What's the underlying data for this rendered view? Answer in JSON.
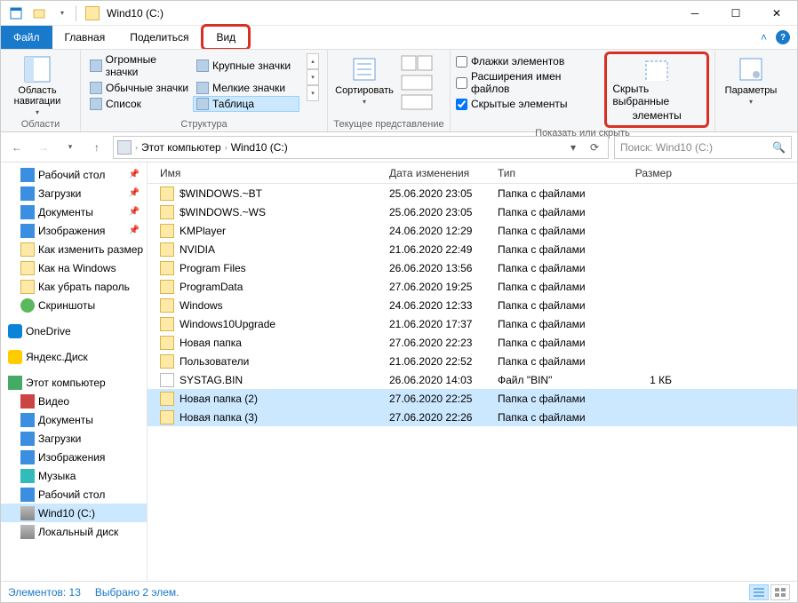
{
  "title": "Wind10 (C:)",
  "tabs": {
    "file": "Файл",
    "home": "Главная",
    "share": "Поделиться",
    "view": "Вид"
  },
  "ribbon": {
    "panes_group": "Области",
    "navpanes_btn": "Область навигации",
    "layout_group": "Структура",
    "layouts": {
      "extra_large": "Огромные значки",
      "large": "Крупные значки",
      "medium": "Обычные значки",
      "small": "Мелкие значки",
      "list": "Список",
      "details": "Таблица"
    },
    "currentview_group": "Текущее представление",
    "sort_btn": "Сортировать",
    "showhide_group": "Показать или скрыть",
    "chk_checkboxes": "Флажки элементов",
    "chk_extensions": "Расширения имен файлов",
    "chk_hidden": "Скрытые элементы",
    "hide_btn_l1": "Скрыть выбранные",
    "hide_btn_l2": "элементы",
    "options_btn": "Параметры"
  },
  "breadcrumb": {
    "pc": "Этот компьютер",
    "drive": "Wind10 (C:)"
  },
  "search_placeholder": "Поиск: Wind10 (C:)",
  "sidebar": {
    "quick": [
      {
        "label": "Рабочий стол",
        "icon": "ico-desktop",
        "pinned": true
      },
      {
        "label": "Загрузки",
        "icon": "ico-down",
        "pinned": true
      },
      {
        "label": "Документы",
        "icon": "ico-doc",
        "pinned": true
      },
      {
        "label": "Изображения",
        "icon": "ico-pic",
        "pinned": true
      },
      {
        "label": "Как изменить размер",
        "icon": "ico-folder",
        "pinned": true
      },
      {
        "label": "Как на Windows",
        "icon": "ico-folder"
      },
      {
        "label": "Как убрать пароль",
        "icon": "ico-folder"
      },
      {
        "label": "Скриншоты",
        "icon": "ico-check"
      }
    ],
    "onedrive": "OneDrive",
    "yadisk": "Яндекс.Диск",
    "this_pc": "Этот компьютер",
    "pc_items": [
      {
        "label": "Видео",
        "icon": "ico-video"
      },
      {
        "label": "Документы",
        "icon": "ico-doc"
      },
      {
        "label": "Загрузки",
        "icon": "ico-down"
      },
      {
        "label": "Изображения",
        "icon": "ico-pic"
      },
      {
        "label": "Музыка",
        "icon": "ico-music"
      },
      {
        "label": "Рабочий стол",
        "icon": "ico-desktop"
      },
      {
        "label": "Wind10 (C:)",
        "icon": "ico-drive",
        "selected": true
      },
      {
        "label": "Локальный диск",
        "icon": "ico-drive"
      }
    ]
  },
  "columns": {
    "name": "Имя",
    "date": "Дата изменения",
    "type": "Тип",
    "size": "Размер"
  },
  "files": [
    {
      "name": "$WINDOWS.~BT",
      "date": "25.06.2020 23:05",
      "type": "Папка с файлами",
      "size": "",
      "icon": "r-folder"
    },
    {
      "name": "$WINDOWS.~WS",
      "date": "25.06.2020 23:05",
      "type": "Папка с файлами",
      "size": "",
      "icon": "r-folder"
    },
    {
      "name": "KMPlayer",
      "date": "24.06.2020 12:29",
      "type": "Папка с файлами",
      "size": "",
      "icon": "r-folder"
    },
    {
      "name": "NVIDIA",
      "date": "21.06.2020 22:49",
      "type": "Папка с файлами",
      "size": "",
      "icon": "r-folder"
    },
    {
      "name": "Program Files",
      "date": "26.06.2020 13:56",
      "type": "Папка с файлами",
      "size": "",
      "icon": "r-folder"
    },
    {
      "name": "ProgramData",
      "date": "27.06.2020 19:25",
      "type": "Папка с файлами",
      "size": "",
      "icon": "r-folder"
    },
    {
      "name": "Windows",
      "date": "24.06.2020 12:33",
      "type": "Папка с файлами",
      "size": "",
      "icon": "r-folder"
    },
    {
      "name": "Windows10Upgrade",
      "date": "21.06.2020 17:37",
      "type": "Папка с файлами",
      "size": "",
      "icon": "r-folder"
    },
    {
      "name": "Новая папка",
      "date": "27.06.2020 22:23",
      "type": "Папка с файлами",
      "size": "",
      "icon": "r-folder"
    },
    {
      "name": "Пользователи",
      "date": "21.06.2020 22:52",
      "type": "Папка с файлами",
      "size": "",
      "icon": "r-folder"
    },
    {
      "name": "SYSTAG.BIN",
      "date": "26.06.2020 14:03",
      "type": "Файл \"BIN\"",
      "size": "1 КБ",
      "icon": "r-file"
    },
    {
      "name": "Новая папка (2)",
      "date": "27.06.2020 22:25",
      "type": "Папка с файлами",
      "size": "",
      "icon": "r-folder",
      "selected": true
    },
    {
      "name": "Новая папка (3)",
      "date": "27.06.2020 22:26",
      "type": "Папка с файлами",
      "size": "",
      "icon": "r-folder",
      "selected": true
    }
  ],
  "status": {
    "count": "Элементов: 13",
    "selected": "Выбрано 2 элем."
  }
}
